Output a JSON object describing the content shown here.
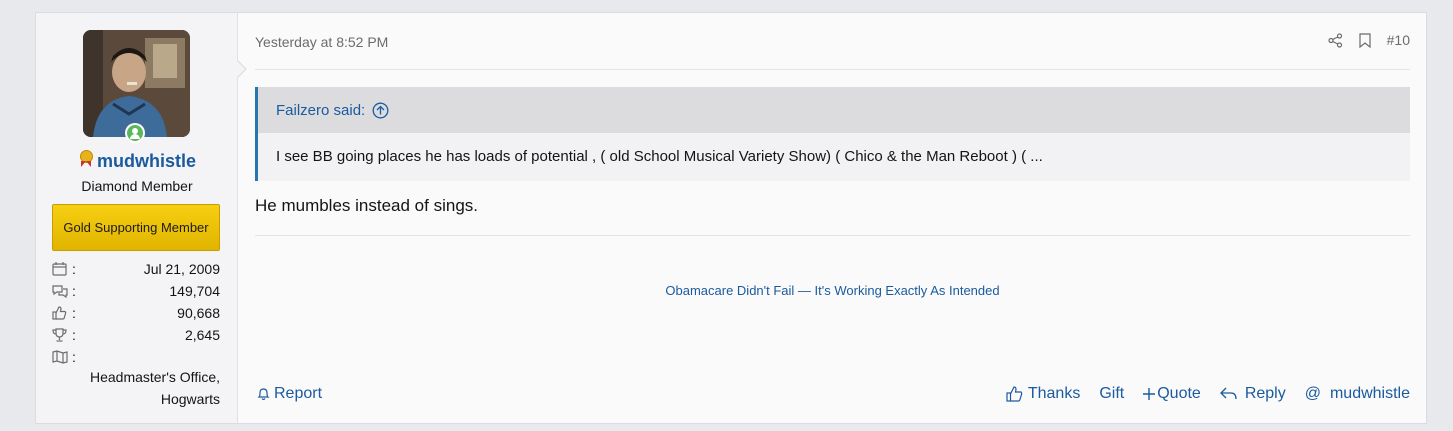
{
  "user": {
    "name": "mudwhistle",
    "title": "Diamond Member",
    "banner": "Gold Supporting Member",
    "stats": [
      {
        "icon": "calendar-icon",
        "value": "Jul 21, 2009"
      },
      {
        "icon": "messages-icon",
        "value": "149,704"
      },
      {
        "icon": "thumbs-up-icon",
        "value": "90,668"
      },
      {
        "icon": "trophy-icon",
        "value": "2,645"
      },
      {
        "icon": "map-icon",
        "value": ""
      }
    ],
    "location": "Headmaster's Office, Hogwarts"
  },
  "post": {
    "date": "Yesterday at 8:52 PM",
    "number": "#10",
    "quote": {
      "author": "Failzero said:",
      "text": "I see BB going places he has loads of potential , ( old School Musical Variety Show) ( Chico & the Man Reboot ) ( ..."
    },
    "message": "He mumbles instead of sings.",
    "signature": "Obamacare Didn't Fail — It's Working Exactly As Intended"
  },
  "actions": {
    "report": "Report",
    "thanks": "Thanks",
    "gift": "Gift",
    "quote": "Quote",
    "reply": "Reply",
    "mention": "mudwhistle"
  },
  "colors": {
    "link": "#1a5a9e",
    "quote_border": "#2577b1",
    "banner": "#f2c811",
    "online": "#5ab85c"
  }
}
